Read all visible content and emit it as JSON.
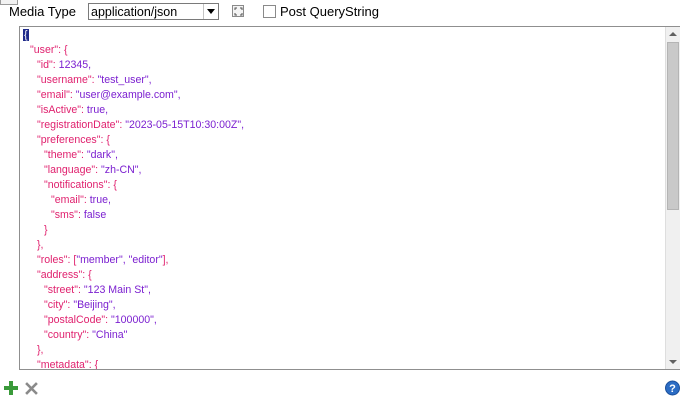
{
  "toolbar": {
    "media_type_label": "Media Type",
    "media_type_value": "application/json",
    "post_querystring_label": "Post QueryString",
    "post_querystring_checked": false
  },
  "editor": {
    "lines": [
      {
        "indent": 0,
        "key": "",
        "value": "{",
        "type": "open"
      },
      {
        "indent": 1,
        "key": "\"user\"",
        "value": "{",
        "type": "obj"
      },
      {
        "indent": 2,
        "key": "\"id\"",
        "value": "12345,",
        "type": "num"
      },
      {
        "indent": 2,
        "key": "\"username\"",
        "value": "\"test_user\",",
        "type": "str"
      },
      {
        "indent": 2,
        "key": "\"email\"",
        "value": "\"user@example.com\",",
        "type": "str"
      },
      {
        "indent": 2,
        "key": "\"isActive\"",
        "value": "true,",
        "type": "bool"
      },
      {
        "indent": 2,
        "key": "\"registrationDate\"",
        "value": "\"2023-05-15T10:30:00Z\",",
        "type": "str"
      },
      {
        "indent": 2,
        "key": "\"preferences\"",
        "value": "{",
        "type": "obj"
      },
      {
        "indent": 3,
        "key": "\"theme\"",
        "value": "\"dark\",",
        "type": "str"
      },
      {
        "indent": 3,
        "key": "\"language\"",
        "value": "\"zh-CN\",",
        "type": "str"
      },
      {
        "indent": 3,
        "key": "\"notifications\"",
        "value": "{",
        "type": "obj"
      },
      {
        "indent": 4,
        "key": "\"email\"",
        "value": "true,",
        "type": "bool"
      },
      {
        "indent": 4,
        "key": "\"sms\"",
        "value": "false",
        "type": "bool"
      },
      {
        "indent": 3,
        "key": "",
        "value": "}",
        "type": "close"
      },
      {
        "indent": 2,
        "key": "",
        "value": "},",
        "type": "close"
      },
      {
        "indent": 2,
        "key": "\"roles\"",
        "value": "[\"member\", \"editor\"],",
        "type": "arr"
      },
      {
        "indent": 2,
        "key": "\"address\"",
        "value": "{",
        "type": "obj"
      },
      {
        "indent": 3,
        "key": "\"street\"",
        "value": "\"123 Main St\",",
        "type": "str"
      },
      {
        "indent": 3,
        "key": "\"city\"",
        "value": "\"Beijing\",",
        "type": "str"
      },
      {
        "indent": 3,
        "key": "\"postalCode\"",
        "value": "\"100000\",",
        "type": "str"
      },
      {
        "indent": 3,
        "key": "\"country\"",
        "value": "\"China\"",
        "type": "str"
      },
      {
        "indent": 2,
        "key": "",
        "value": "},",
        "type": "close"
      },
      {
        "indent": 2,
        "key": "\"metadata\"",
        "value": "{",
        "type": "obj"
      }
    ]
  },
  "colors": {
    "key": "#e0216e",
    "value": "#7b1fd0",
    "add_icon": "#3a9a3a",
    "remove_icon": "#8a8a8a",
    "help_icon": "#2b6cc4"
  },
  "icons": {
    "add": "plus-icon",
    "remove": "x-icon",
    "help": "question-icon",
    "expand": "expand-icon"
  }
}
